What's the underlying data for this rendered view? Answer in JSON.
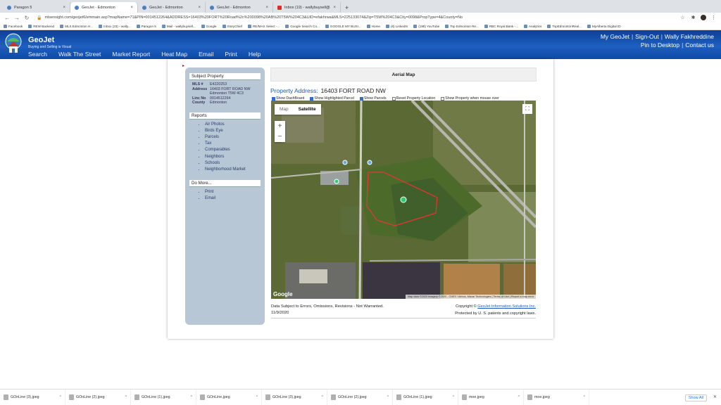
{
  "browser": {
    "tabs": [
      {
        "label": "Paragon 5",
        "icon": "paragon-icon",
        "active": false
      },
      {
        "label": "GeoJet - Edmonton",
        "icon": "geojet-icon",
        "active": true
      },
      {
        "label": "GeoJet - Edmonton",
        "icon": "geojet-icon",
        "active": false
      },
      {
        "label": "GeoJet - Edmonton",
        "icon": "geojet-icon",
        "active": false
      },
      {
        "label": "Inbox (19) - wallybuysell@gma...",
        "icon": "gmail-icon",
        "active": false
      }
    ],
    "url": "mlsensight.com/geojet6/emmain.asp?mapName=71&PIN=0014512264&ADDRESS=16403%20FORT%20Road%2c%200098%20AB%20T5W%204C3&UID=efakhrwa&MLS=225133074&Zip=T5W%204C3&City=0098&PropType=4&County=No",
    "bookmarks": [
      "Facebook",
      "REW Backend",
      "MLS Edmonton H...",
      "Inbox (23) - wally...",
      "Paragon 5",
      "Mail - wallybuysell...",
      "Google",
      "StoryChief",
      "RE/MAX Select -...",
      "Google Search Co...",
      "GOOGLE MY BUSI...",
      "Home",
      "(6) LinkedIn",
      "(188) YouTube",
      "Top Edmonton Re...",
      "RBC Royal Bank -...",
      "Analytics",
      "TopEdmontonReal...",
      "MyAlberta Digital ID"
    ]
  },
  "header": {
    "brand": "GeoJet",
    "tagline": "Buying and Selling is Visual",
    "nav": [
      "Search",
      "Walk The Street",
      "Market Report",
      "Heat Map",
      "Email",
      "Print",
      "Help"
    ],
    "right_top": [
      "My GeoJet",
      "Sign-Out",
      "Wally Fakhreddine"
    ],
    "right_bottom": [
      "Pin to Desktop",
      "Contact us"
    ]
  },
  "sidebar": {
    "subject_title": "Subject Property",
    "fields": [
      {
        "label": "MLS #",
        "value": "E4220253"
      },
      {
        "label": "Address",
        "value": "16403 FORT ROAD NW Edmonton T5W 4C3"
      },
      {
        "label": "Linc No",
        "value": "0014512264"
      },
      {
        "label": "County",
        "value": "Edmonton"
      }
    ],
    "reports_title": "Reports",
    "reports": [
      "Air Photos",
      "Birds Eye",
      "Parcels",
      "Tax",
      "Comparables",
      "Neighbors",
      "Schools",
      "Neighborhood Market"
    ],
    "more_title": "Do More...",
    "more": [
      "Print",
      "Email"
    ]
  },
  "main": {
    "heading": "Aerial Map",
    "address_label": "Property Address:",
    "address_value": "16403 FORT ROAD NW",
    "checkboxes": [
      {
        "label": "Show DashBoard",
        "checked": true
      },
      {
        "label": "Show Highlighted Parcel",
        "checked": true
      },
      {
        "label": "Show Parcels",
        "checked": true
      },
      {
        "label": "Reset Property Location",
        "checked": false
      },
      {
        "label": "Show Property when mouse over",
        "checked": false
      }
    ],
    "map": {
      "type_options": [
        "Map",
        "Satellite"
      ],
      "selected_type": "Satellite",
      "zoom_in": "+",
      "zoom_out": "−",
      "logo": "Google",
      "attribution": "Map data ©2020 Imagery ©2020 , CNES / Airbus, Maxar Technologies | Terms of Use | Report a map error"
    },
    "disclaimer": "Data Subject to Errors, Omissions, Revisions - Not Warranted.",
    "date": "11/9/2020",
    "copyright_prefix": "Copyright ©",
    "copyright_link": "GeoJet Information Solutions Inc.",
    "patent": "Protected by U. S. patents and copyright laws."
  },
  "downloads": {
    "items": [
      "GOnLine (3).jpeg",
      "GOnLine (2).jpeg",
      "GOnLine (1).jpeg",
      "GOnLine.jpeg",
      "GOnLine (3).jpeg",
      "GOnLine (2).jpeg",
      "GOnLine (1).jpeg",
      "moe.jpeg",
      "moe.jpeg"
    ],
    "show_all": "Show All"
  }
}
